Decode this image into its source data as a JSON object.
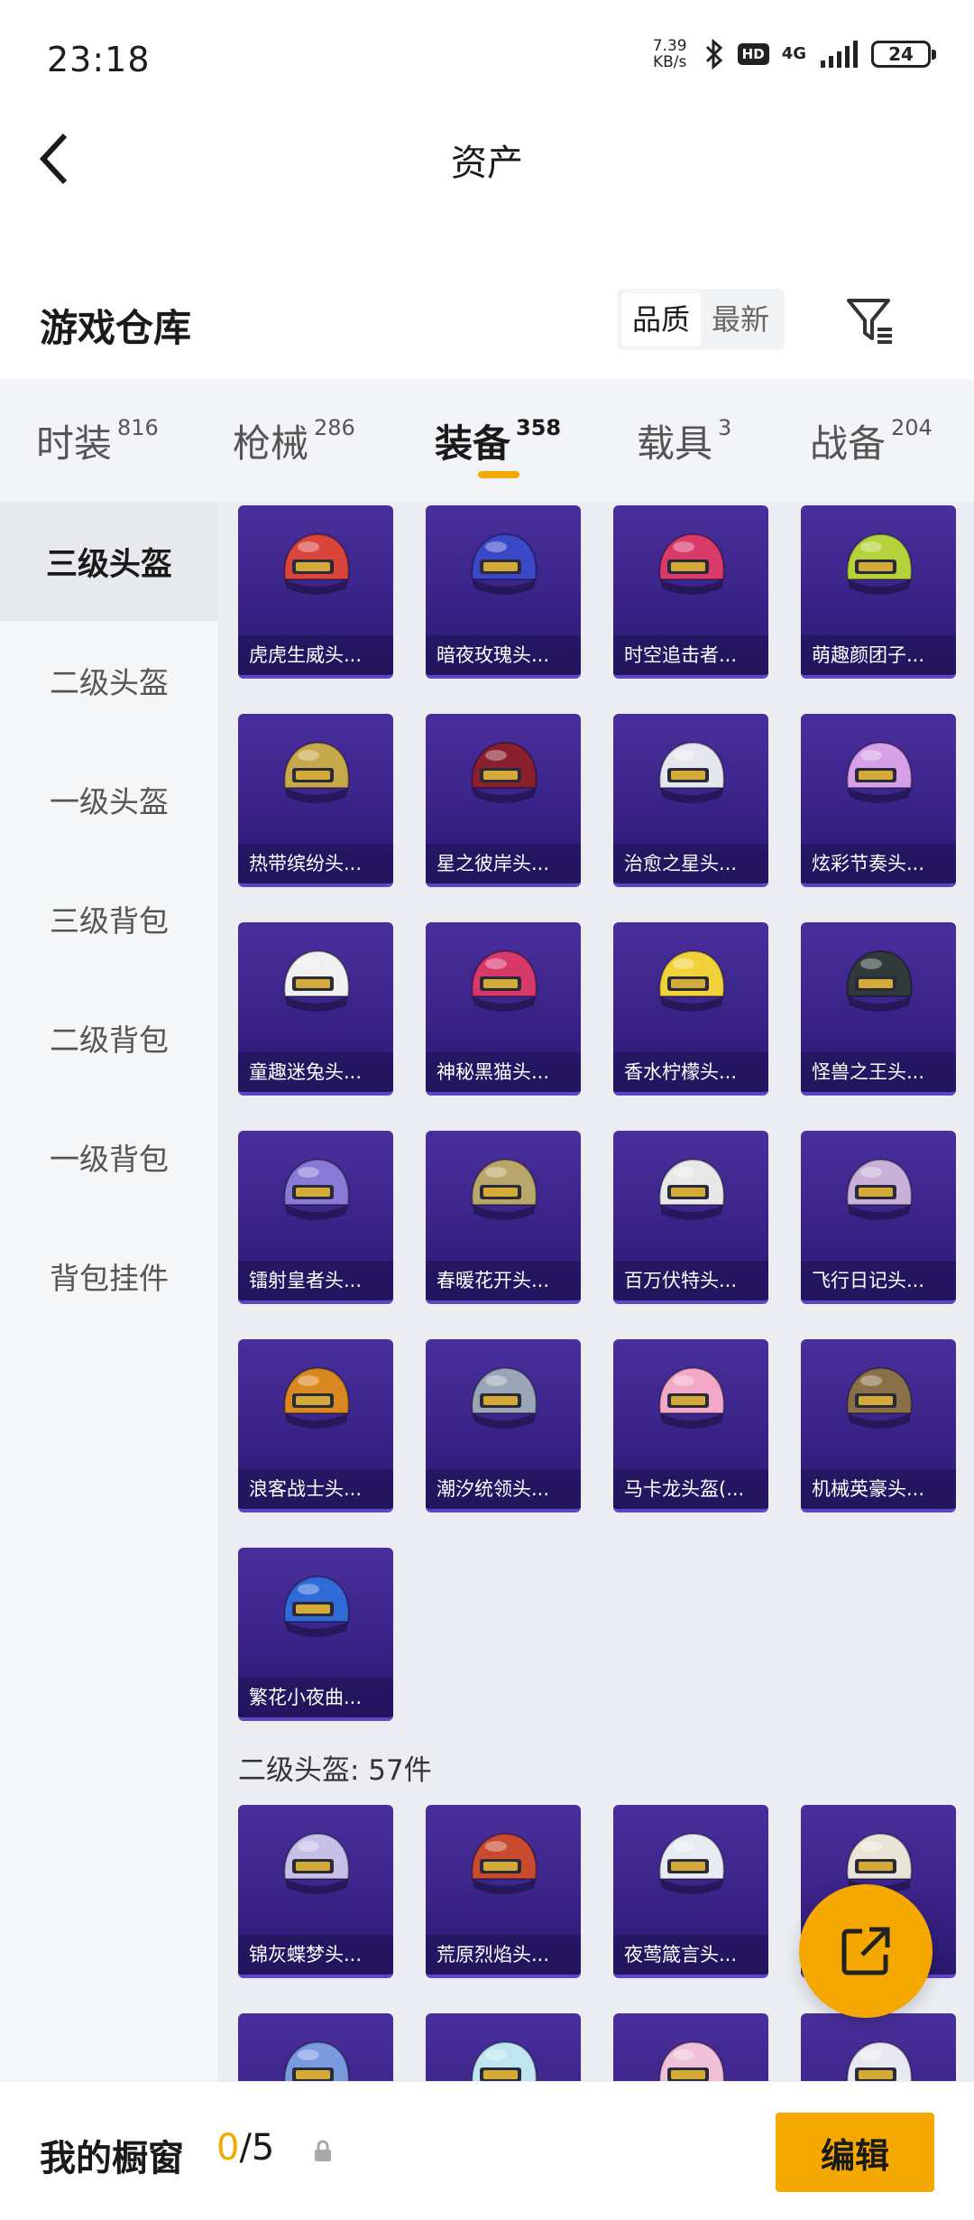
{
  "status": {
    "time": "23:18",
    "net_speed_value": "7.39",
    "net_speed_unit": "KB/s",
    "hd": "HD",
    "net_type": "4G",
    "battery": "24"
  },
  "nav": {
    "title": "资产"
  },
  "section": {
    "title": "游戏仓库",
    "sort_options": [
      "品质",
      "最新"
    ]
  },
  "tabs": [
    {
      "label": "时装",
      "count": "816"
    },
    {
      "label": "枪械",
      "count": "286"
    },
    {
      "label": "装备",
      "count": "358"
    },
    {
      "label": "载具",
      "count": "3"
    },
    {
      "label": "战备",
      "count": "204"
    }
  ],
  "sidebar": {
    "items": [
      "三级头盔",
      "二级头盔",
      "一级头盔",
      "三级背包",
      "二级背包",
      "一级背包",
      "背包挂件"
    ]
  },
  "level3_items": [
    {
      "name": "虎虎生威头...",
      "color": "#d9453b"
    },
    {
      "name": "暗夜玫瑰头...",
      "color": "#3b49c8"
    },
    {
      "name": "时空追击者...",
      "color": "#d83a6a"
    },
    {
      "name": "萌趣颜团子...",
      "color": "#b5d23a"
    },
    {
      "name": "热带缤纷头...",
      "color": "#c7a84a"
    },
    {
      "name": "星之彼岸头...",
      "color": "#8a1f2e"
    },
    {
      "name": "治愈之星头...",
      "color": "#e6e6ee"
    },
    {
      "name": "炫彩节奏头...",
      "color": "#d8a0e8"
    },
    {
      "name": "童趣迷兔头...",
      "color": "#f0f0f0"
    },
    {
      "name": "神秘黑猫头...",
      "color": "#d9386a"
    },
    {
      "name": "香水柠檬头...",
      "color": "#f2d23a"
    },
    {
      "name": "怪兽之王头...",
      "color": "#2f3a3a"
    },
    {
      "name": "镭射皇者头...",
      "color": "#8a7ad8"
    },
    {
      "name": "春暖花开头...",
      "color": "#b8a66a"
    },
    {
      "name": "百万伏特头...",
      "color": "#e8e8e8"
    },
    {
      "name": "飞行日记头...",
      "color": "#c8b0d8"
    },
    {
      "name": "浪客战士头...",
      "color": "#d8881f"
    },
    {
      "name": "潮汐统领头...",
      "color": "#9aa6b8"
    },
    {
      "name": "马卡龙头盔(...",
      "color": "#f3a8c8"
    },
    {
      "name": "机械英豪头...",
      "color": "#8a7048"
    },
    {
      "name": "繁花小夜曲...",
      "color": "#2f6ad8"
    }
  ],
  "level2_label": "二级头盔: 57件",
  "level2_items": [
    {
      "name": "锦灰蝶梦头...",
      "color": "#c6c0e8"
    },
    {
      "name": "荒原烈焰头...",
      "color": "#c84a2f"
    },
    {
      "name": "夜莺箴言头...",
      "color": "#e6ecf2"
    },
    {
      "name": "",
      "color": "#e8e4d8"
    },
    {
      "name": "",
      "color": "#7a9ae0"
    },
    {
      "name": "",
      "color": "#bfe6f0"
    },
    {
      "name": "",
      "color": "#f0c0d8"
    },
    {
      "name": "",
      "color": "#e8e8f0"
    }
  ],
  "bottom": {
    "showcase_label": "我的橱窗",
    "showcase_current": "0",
    "showcase_total": "/5",
    "edit_label": "编辑"
  },
  "colors": {
    "accent": "#f5a800",
    "card_bg": "#3b2590"
  }
}
